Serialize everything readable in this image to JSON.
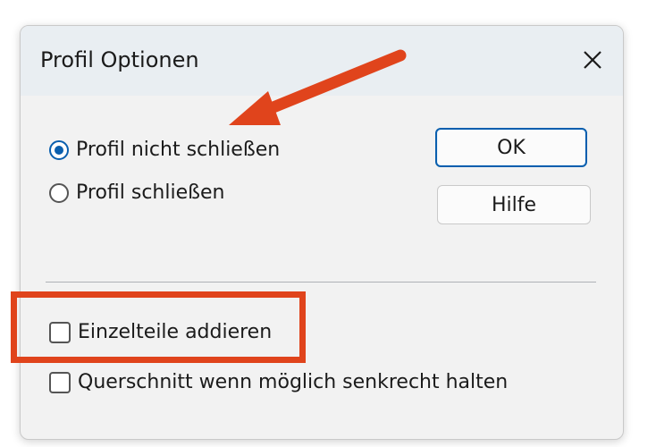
{
  "dialog": {
    "title": "Profil Optionen",
    "close_icon": "close-icon"
  },
  "options": {
    "radios": [
      {
        "label": "Profil nicht schließen",
        "checked": true
      },
      {
        "label": "Profil schließen",
        "checked": false
      }
    ],
    "checkboxes": [
      {
        "label": "Einzelteile addieren",
        "checked": false
      },
      {
        "label": "Querschnitt wenn möglich senkrecht halten",
        "checked": false
      }
    ]
  },
  "buttons": {
    "ok": "OK",
    "help": "Hilfe"
  },
  "colors": {
    "accent": "#0a5fae",
    "annotation": "#e0441c",
    "dialog_bg": "#f2f2f2",
    "titlebar_bg": "#e9eef2"
  }
}
